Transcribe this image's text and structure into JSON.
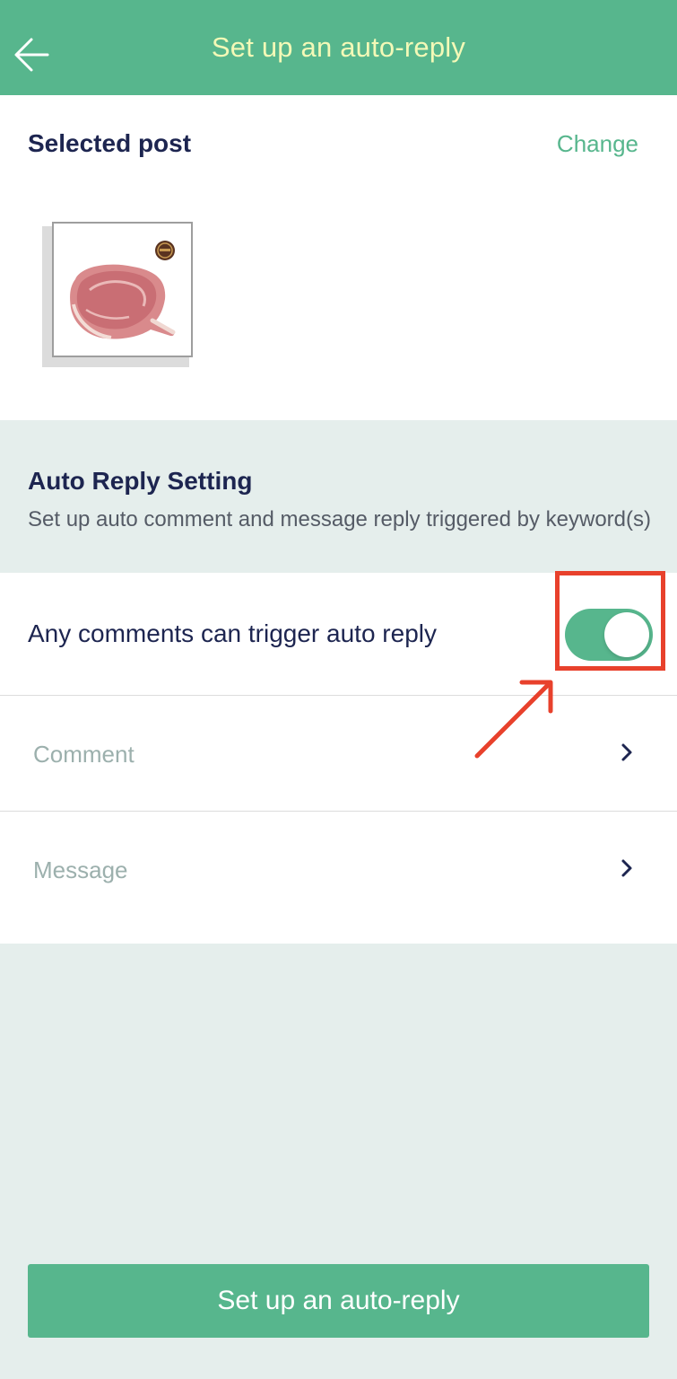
{
  "header": {
    "title": "Set up an auto-reply",
    "back_icon": "arrow-left-icon"
  },
  "post": {
    "section_title": "Selected post",
    "change_label": "Change",
    "thumbnail": "pork-chop-photo"
  },
  "auto_reply": {
    "title": "Auto Reply Setting",
    "description": "Set up auto comment and message reply triggered by keyword(s)",
    "any_comment_toggle": {
      "label": "Any comments can trigger auto reply",
      "on": true
    },
    "rows": [
      {
        "label": "Comment",
        "icon": "chevron-right-icon"
      },
      {
        "label": "Message",
        "icon": "chevron-right-icon"
      }
    ]
  },
  "footer": {
    "submit_label": "Set up an auto-reply"
  },
  "colors": {
    "brand_green": "#57b68d",
    "header_text": "#f3f9b7",
    "heading_navy": "#1d2550",
    "annotation_red": "#e8412c"
  }
}
